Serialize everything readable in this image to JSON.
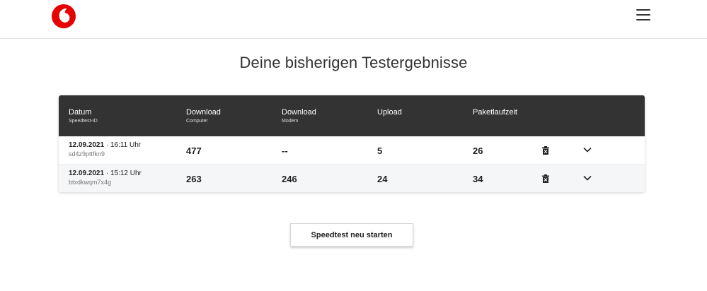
{
  "page": {
    "title": "Deine bisherigen Testergebnisse"
  },
  "brand": {
    "accent_color": "#e60000",
    "logo_icon": "vodafone-logo-icon"
  },
  "header": {
    "menu_icon": "hamburger-menu-icon"
  },
  "table": {
    "columns": [
      {
        "label": "Datum",
        "sub": "Speedtest-ID"
      },
      {
        "label": "Download",
        "sub": "Computer"
      },
      {
        "label": "Download",
        "sub": "Modem"
      },
      {
        "label": "Upload",
        "sub": ""
      },
      {
        "label": "Paketlaufzeit",
        "sub": ""
      }
    ],
    "rows": [
      {
        "date": "12.09.2021",
        "time": "· 16:11 Uhr",
        "test_id": "sd4z9pttfkn9",
        "download_computer": "477",
        "download_modem": "--",
        "upload": "5",
        "ping": "26",
        "delete_icon": "trash-icon",
        "expand_icon": "chevron-down-icon"
      },
      {
        "date": "12.09.2021",
        "time": "· 15:12 Uhr",
        "test_id": "btxdkwqm7x4g",
        "download_computer": "263",
        "download_modem": "246",
        "upload": "24",
        "ping": "34",
        "delete_icon": "trash-icon",
        "expand_icon": "chevron-down-icon"
      }
    ]
  },
  "actions": {
    "restart_label": "Speedtest neu starten"
  }
}
